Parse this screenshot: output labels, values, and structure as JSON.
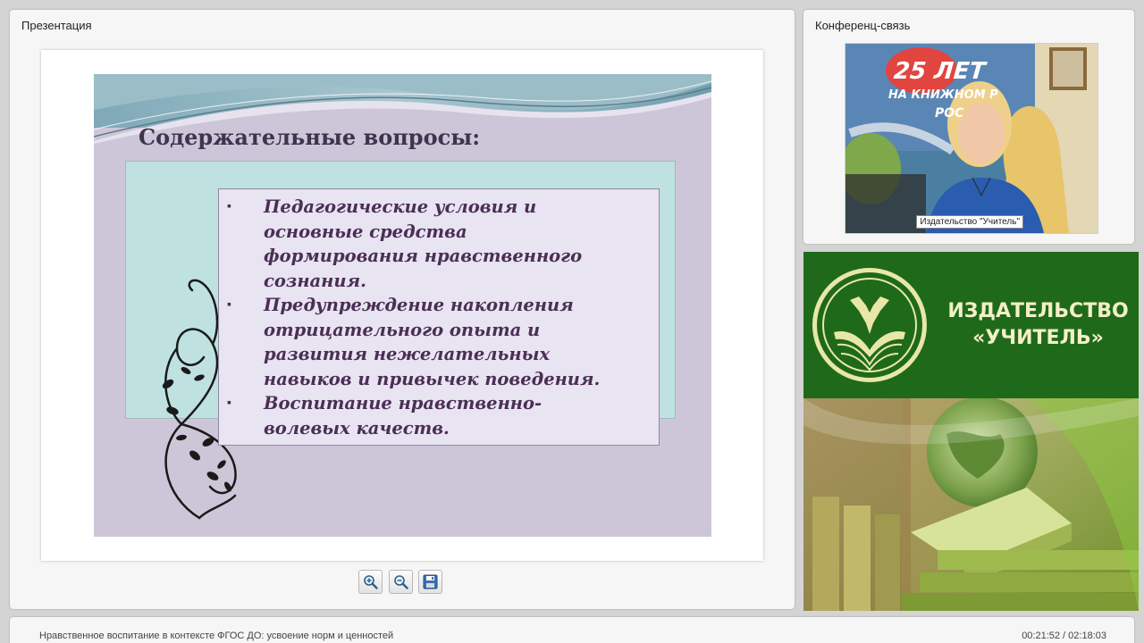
{
  "presentation": {
    "title": "Презентация",
    "slide": {
      "heading": "Содержательные вопросы:",
      "bullets": [
        "Педагогические  условия и\nосновные средства\nформирования  нравственного\nсознания.",
        "Предупреждение накопления\nотрицательного опыта и\nразвития нежелательных\nнавыков и привычек поведения.",
        "Воспитание нравственно-\nволевых качеств."
      ]
    },
    "toolbar": {
      "zoom_in": "zoom-in-icon",
      "zoom_out": "zoom-out-icon",
      "save": "save-icon"
    }
  },
  "conference": {
    "title": "Конференц-связь",
    "caption": "Издательство \"Учитель\"",
    "poster_text": [
      "25 ЛЕТ",
      "НА КНИЖНОМ Р",
      "РОС"
    ]
  },
  "branding": {
    "name_line1": "ИЗДАТЕЛЬСТВО",
    "name_line2": "«УЧИТЕЛЬ»",
    "colors": {
      "green": "#1f6a1a",
      "cream": "#f3f0c6"
    }
  },
  "status": {
    "course_title": "Нравственное воспитание в контексте ФГОС ДО: усвоение норм и ценностей",
    "time": "00:21:52 / 02:18:03"
  }
}
